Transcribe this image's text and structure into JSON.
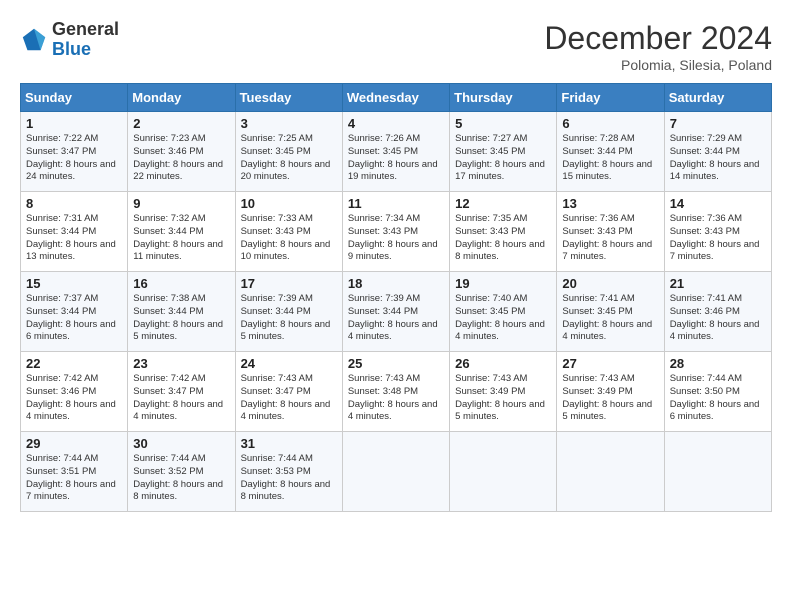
{
  "header": {
    "logo_line1": "General",
    "logo_line2": "Blue",
    "month": "December 2024",
    "location": "Polomia, Silesia, Poland"
  },
  "days_of_week": [
    "Sunday",
    "Monday",
    "Tuesday",
    "Wednesday",
    "Thursday",
    "Friday",
    "Saturday"
  ],
  "weeks": [
    [
      {
        "day": "1",
        "sunrise": "Sunrise: 7:22 AM",
        "sunset": "Sunset: 3:47 PM",
        "daylight": "Daylight: 8 hours and 24 minutes."
      },
      {
        "day": "2",
        "sunrise": "Sunrise: 7:23 AM",
        "sunset": "Sunset: 3:46 PM",
        "daylight": "Daylight: 8 hours and 22 minutes."
      },
      {
        "day": "3",
        "sunrise": "Sunrise: 7:25 AM",
        "sunset": "Sunset: 3:45 PM",
        "daylight": "Daylight: 8 hours and 20 minutes."
      },
      {
        "day": "4",
        "sunrise": "Sunrise: 7:26 AM",
        "sunset": "Sunset: 3:45 PM",
        "daylight": "Daylight: 8 hours and 19 minutes."
      },
      {
        "day": "5",
        "sunrise": "Sunrise: 7:27 AM",
        "sunset": "Sunset: 3:45 PM",
        "daylight": "Daylight: 8 hours and 17 minutes."
      },
      {
        "day": "6",
        "sunrise": "Sunrise: 7:28 AM",
        "sunset": "Sunset: 3:44 PM",
        "daylight": "Daylight: 8 hours and 15 minutes."
      },
      {
        "day": "7",
        "sunrise": "Sunrise: 7:29 AM",
        "sunset": "Sunset: 3:44 PM",
        "daylight": "Daylight: 8 hours and 14 minutes."
      }
    ],
    [
      {
        "day": "8",
        "sunrise": "Sunrise: 7:31 AM",
        "sunset": "Sunset: 3:44 PM",
        "daylight": "Daylight: 8 hours and 13 minutes."
      },
      {
        "day": "9",
        "sunrise": "Sunrise: 7:32 AM",
        "sunset": "Sunset: 3:44 PM",
        "daylight": "Daylight: 8 hours and 11 minutes."
      },
      {
        "day": "10",
        "sunrise": "Sunrise: 7:33 AM",
        "sunset": "Sunset: 3:43 PM",
        "daylight": "Daylight: 8 hours and 10 minutes."
      },
      {
        "day": "11",
        "sunrise": "Sunrise: 7:34 AM",
        "sunset": "Sunset: 3:43 PM",
        "daylight": "Daylight: 8 hours and 9 minutes."
      },
      {
        "day": "12",
        "sunrise": "Sunrise: 7:35 AM",
        "sunset": "Sunset: 3:43 PM",
        "daylight": "Daylight: 8 hours and 8 minutes."
      },
      {
        "day": "13",
        "sunrise": "Sunrise: 7:36 AM",
        "sunset": "Sunset: 3:43 PM",
        "daylight": "Daylight: 8 hours and 7 minutes."
      },
      {
        "day": "14",
        "sunrise": "Sunrise: 7:36 AM",
        "sunset": "Sunset: 3:43 PM",
        "daylight": "Daylight: 8 hours and 7 minutes."
      }
    ],
    [
      {
        "day": "15",
        "sunrise": "Sunrise: 7:37 AM",
        "sunset": "Sunset: 3:44 PM",
        "daylight": "Daylight: 8 hours and 6 minutes."
      },
      {
        "day": "16",
        "sunrise": "Sunrise: 7:38 AM",
        "sunset": "Sunset: 3:44 PM",
        "daylight": "Daylight: 8 hours and 5 minutes."
      },
      {
        "day": "17",
        "sunrise": "Sunrise: 7:39 AM",
        "sunset": "Sunset: 3:44 PM",
        "daylight": "Daylight: 8 hours and 5 minutes."
      },
      {
        "day": "18",
        "sunrise": "Sunrise: 7:39 AM",
        "sunset": "Sunset: 3:44 PM",
        "daylight": "Daylight: 8 hours and 4 minutes."
      },
      {
        "day": "19",
        "sunrise": "Sunrise: 7:40 AM",
        "sunset": "Sunset: 3:45 PM",
        "daylight": "Daylight: 8 hours and 4 minutes."
      },
      {
        "day": "20",
        "sunrise": "Sunrise: 7:41 AM",
        "sunset": "Sunset: 3:45 PM",
        "daylight": "Daylight: 8 hours and 4 minutes."
      },
      {
        "day": "21",
        "sunrise": "Sunrise: 7:41 AM",
        "sunset": "Sunset: 3:46 PM",
        "daylight": "Daylight: 8 hours and 4 minutes."
      }
    ],
    [
      {
        "day": "22",
        "sunrise": "Sunrise: 7:42 AM",
        "sunset": "Sunset: 3:46 PM",
        "daylight": "Daylight: 8 hours and 4 minutes."
      },
      {
        "day": "23",
        "sunrise": "Sunrise: 7:42 AM",
        "sunset": "Sunset: 3:47 PM",
        "daylight": "Daylight: 8 hours and 4 minutes."
      },
      {
        "day": "24",
        "sunrise": "Sunrise: 7:43 AM",
        "sunset": "Sunset: 3:47 PM",
        "daylight": "Daylight: 8 hours and 4 minutes."
      },
      {
        "day": "25",
        "sunrise": "Sunrise: 7:43 AM",
        "sunset": "Sunset: 3:48 PM",
        "daylight": "Daylight: 8 hours and 4 minutes."
      },
      {
        "day": "26",
        "sunrise": "Sunrise: 7:43 AM",
        "sunset": "Sunset: 3:49 PM",
        "daylight": "Daylight: 8 hours and 5 minutes."
      },
      {
        "day": "27",
        "sunrise": "Sunrise: 7:43 AM",
        "sunset": "Sunset: 3:49 PM",
        "daylight": "Daylight: 8 hours and 5 minutes."
      },
      {
        "day": "28",
        "sunrise": "Sunrise: 7:44 AM",
        "sunset": "Sunset: 3:50 PM",
        "daylight": "Daylight: 8 hours and 6 minutes."
      }
    ],
    [
      {
        "day": "29",
        "sunrise": "Sunrise: 7:44 AM",
        "sunset": "Sunset: 3:51 PM",
        "daylight": "Daylight: 8 hours and 7 minutes."
      },
      {
        "day": "30",
        "sunrise": "Sunrise: 7:44 AM",
        "sunset": "Sunset: 3:52 PM",
        "daylight": "Daylight: 8 hours and 8 minutes."
      },
      {
        "day": "31",
        "sunrise": "Sunrise: 7:44 AM",
        "sunset": "Sunset: 3:53 PM",
        "daylight": "Daylight: 8 hours and 8 minutes."
      },
      null,
      null,
      null,
      null
    ]
  ]
}
